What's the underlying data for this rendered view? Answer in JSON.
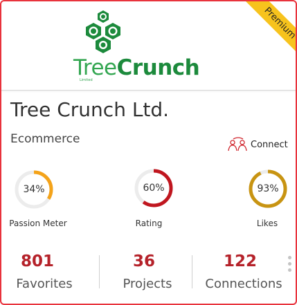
{
  "ribbon": {
    "label": "Premium"
  },
  "logo": {
    "word_tree": "Tree",
    "word_crunch": "Crunch",
    "sub": "Limited"
  },
  "company": {
    "name": "Tree Crunch Ltd.",
    "category": "Ecommerce"
  },
  "connect": {
    "label": "Connect",
    "icon": "connect-people-icon"
  },
  "gauges": [
    {
      "value_text": "34%",
      "value": 0.34,
      "label": "Passion Meter",
      "color": "#f4a31a"
    },
    {
      "value_text": "60%",
      "value": 0.6,
      "label": "Rating",
      "color": "#c0161f"
    },
    {
      "value_text": "93%",
      "value": 0.93,
      "label": "Likes",
      "color": "#c89412"
    }
  ],
  "stats": [
    {
      "value": "801",
      "label": "Favorites"
    },
    {
      "value": "36",
      "label": "Projects"
    },
    {
      "value": "122",
      "label": "Connections"
    }
  ],
  "colors": {
    "border": "#e8323c",
    "accent": "#b5222a",
    "ribbon": "#f7c31d",
    "logo_green": "#1c8a3c"
  }
}
